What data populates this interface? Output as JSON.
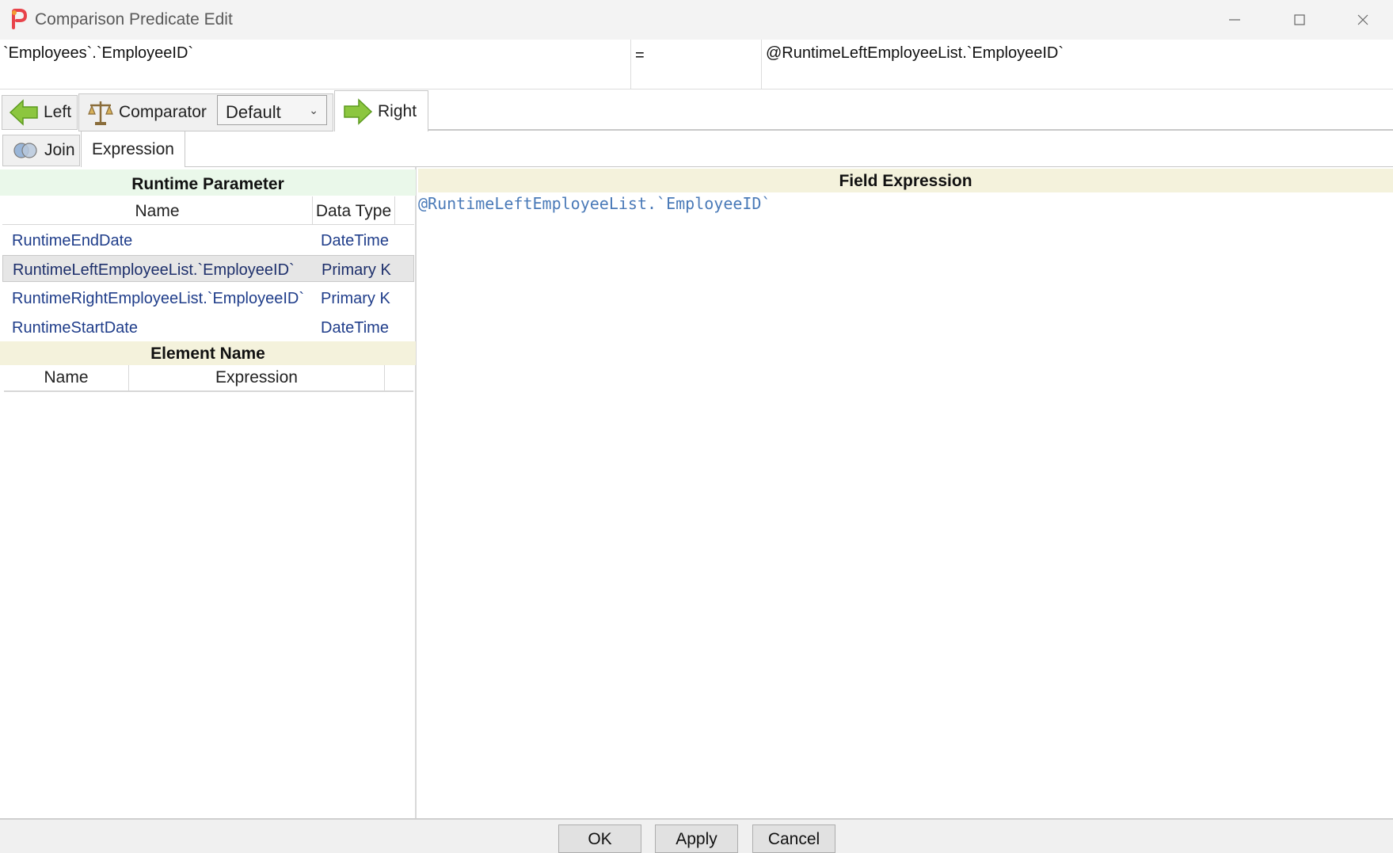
{
  "window": {
    "title": "Comparison Predicate Edit",
    "icons": [
      "app-logo-icon",
      "minimize-icon",
      "maximize-icon",
      "close-icon"
    ]
  },
  "predicate": {
    "left": "`Employees`.`EmployeeID`",
    "operator": "=",
    "right": "@RuntimeLeftEmployeeList.`EmployeeID`"
  },
  "toolbar": {
    "left_label": "Left",
    "comparator_label": "Comparator",
    "comparator_value": "Default",
    "right_label": "Right"
  },
  "subtabs": {
    "join_label": "Join",
    "expression_label": "Expression"
  },
  "runtime_parameter": {
    "title": "Runtime Parameter",
    "columns": [
      "Name",
      "Data Type"
    ],
    "rows": [
      {
        "name": "RuntimeEndDate",
        "type": "DateTime"
      },
      {
        "name": "RuntimeLeftEmployeeList.`EmployeeID`",
        "type": "Primary Key"
      },
      {
        "name": "RuntimeRightEmployeeList.`EmployeeID`",
        "type": "Primary Key"
      },
      {
        "name": "RuntimeStartDate",
        "type": "DateTime"
      }
    ],
    "selected_index": 1
  },
  "element_name": {
    "title": "Element Name",
    "columns": [
      "Name",
      "Expression"
    ]
  },
  "field_expression": {
    "title": "Field Expression",
    "text": "@RuntimeLeftEmployeeList.`EmployeeID`",
    "text_color": "#4a7ab8"
  },
  "buttons": {
    "ok": "OK",
    "apply": "Apply",
    "cancel": "Cancel"
  }
}
